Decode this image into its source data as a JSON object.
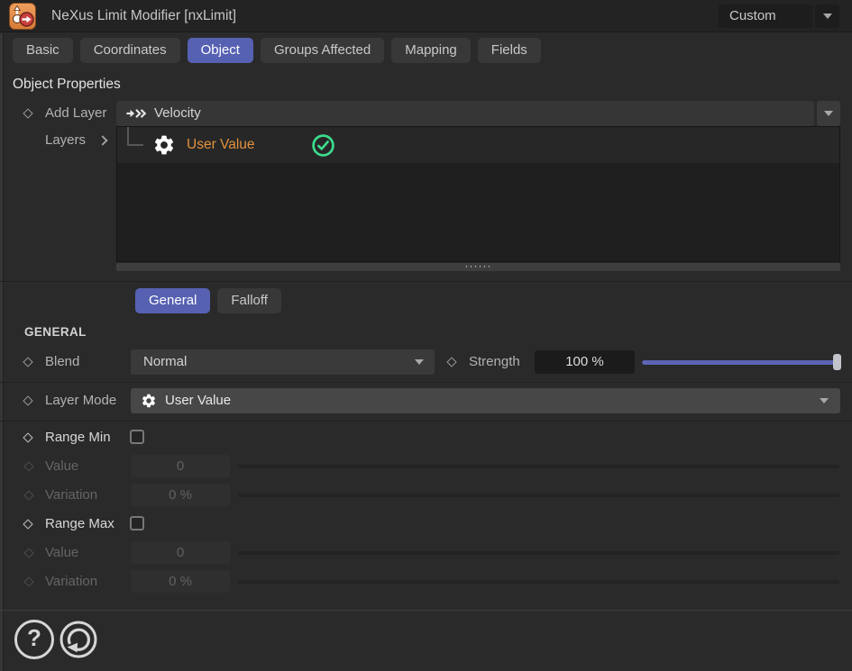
{
  "titlebar": {
    "title": "NeXus Limit Modifier [nxLimit]",
    "preset": "Custom"
  },
  "tabs": [
    {
      "label": "Basic",
      "active": false
    },
    {
      "label": "Coordinates",
      "active": false
    },
    {
      "label": "Object",
      "active": true
    },
    {
      "label": "Groups Affected",
      "active": false
    },
    {
      "label": "Mapping",
      "active": false
    },
    {
      "label": "Fields",
      "active": false
    }
  ],
  "object_properties": {
    "section_title": "Object Properties",
    "add_layer": {
      "label": "Add Layer",
      "value": "Velocity",
      "icon": "velocity-icon"
    },
    "layers": {
      "label": "Layers",
      "items": [
        {
          "name": "User Value",
          "icon": "gear-icon",
          "enabled": true,
          "name_color": "#e2923e"
        }
      ],
      "resize_handle_dots": "······"
    }
  },
  "subtabs": [
    {
      "label": "General",
      "active": true
    },
    {
      "label": "Falloff",
      "active": false
    }
  ],
  "general": {
    "header": "GENERAL",
    "blend": {
      "label": "Blend",
      "value": "Normal"
    },
    "strength": {
      "label": "Strength",
      "value": "100 %",
      "percent": 100
    },
    "layer_mode": {
      "label": "Layer Mode",
      "value": "User Value",
      "icon": "gear-icon"
    },
    "range_min": {
      "label": "Range Min",
      "checked": false,
      "value_row": {
        "label": "Value",
        "value": "0",
        "enabled": false
      },
      "variation_row": {
        "label": "Variation",
        "value": "0 %",
        "enabled": false
      }
    },
    "range_max": {
      "label": "Range Max",
      "checked": false,
      "value_row": {
        "label": "Value",
        "value": "0",
        "enabled": false
      },
      "variation_row": {
        "label": "Variation",
        "value": "0 %",
        "enabled": false
      }
    }
  },
  "footer": {
    "help_glyph": "?"
  },
  "colors": {
    "accent": "#5661b2",
    "selection_orange": "#e2923e",
    "enabled_green": "#3cdc8c",
    "slider_blue": "#5c64b6"
  }
}
